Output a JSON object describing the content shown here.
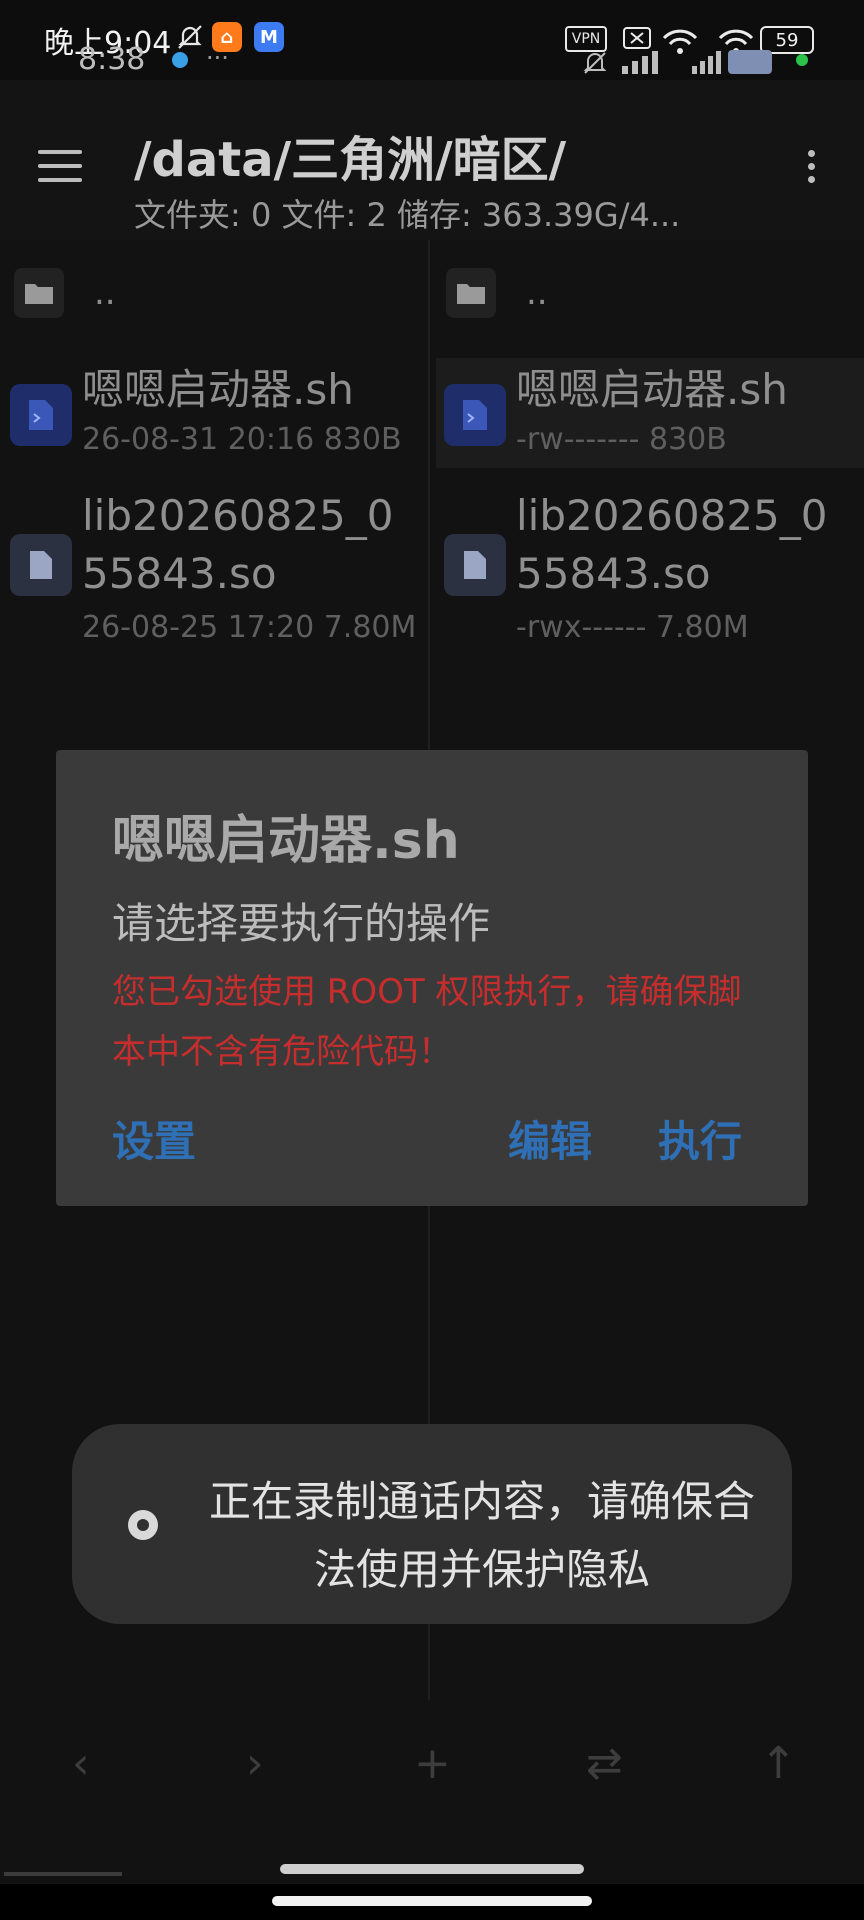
{
  "status_bar": {
    "outer_time": "晚上9:04",
    "inner_time": "8:38",
    "inner_dots": "···",
    "vpn_label": "VPN",
    "battery_level": "59",
    "icons": [
      "mute-bell-icon",
      "app-badge-icon",
      "mail-icon",
      "vpn-icon",
      "no-sim-icon",
      "signal-icon",
      "wifi-icon",
      "battery-icon"
    ]
  },
  "appbar": {
    "path_title": "/data/三角洲/暗区/",
    "subtitle": "文件夹: 0  文件: 2  储存: 363.39G/4..."
  },
  "panes": {
    "left": {
      "parent_label": "..",
      "files": [
        {
          "name": "嗯嗯启动器.sh",
          "meta": "26-08-31 20:16 830B"
        },
        {
          "name_line1": "lib20260825_0",
          "name_line2": "55843.so",
          "meta": "26-08-25 17:20 7.80M"
        }
      ]
    },
    "right": {
      "parent_label": "..",
      "files": [
        {
          "name": "嗯嗯启动器.sh",
          "meta": "-rw------- 830B"
        },
        {
          "name_line1": "lib20260825_0",
          "name_line2": "55843.so",
          "meta": "-rwx------ 7.80M"
        }
      ]
    }
  },
  "dialog": {
    "title": "嗯嗯启动器.sh",
    "message": "请选择要执行的操作",
    "warning": "您已勾选使用 ROOT 权限执行，请确保脚本中不含有危险代码！",
    "settings_label": "设置",
    "edit_label": "编辑",
    "execute_label": "执行"
  },
  "toast": {
    "text": "正在录制通话内容，请确保合法使用并保护隐私"
  },
  "bottom_nav": {
    "back": "‹",
    "forward": "›",
    "add": "+",
    "swap": "⇄",
    "up": "↑"
  },
  "colors": {
    "background": "#121212",
    "dialog": "#3a3a3a",
    "accent_blue": "#2f6fb5",
    "warning_red": "#c62d2d",
    "sh_tile": "#1f2e6b"
  }
}
